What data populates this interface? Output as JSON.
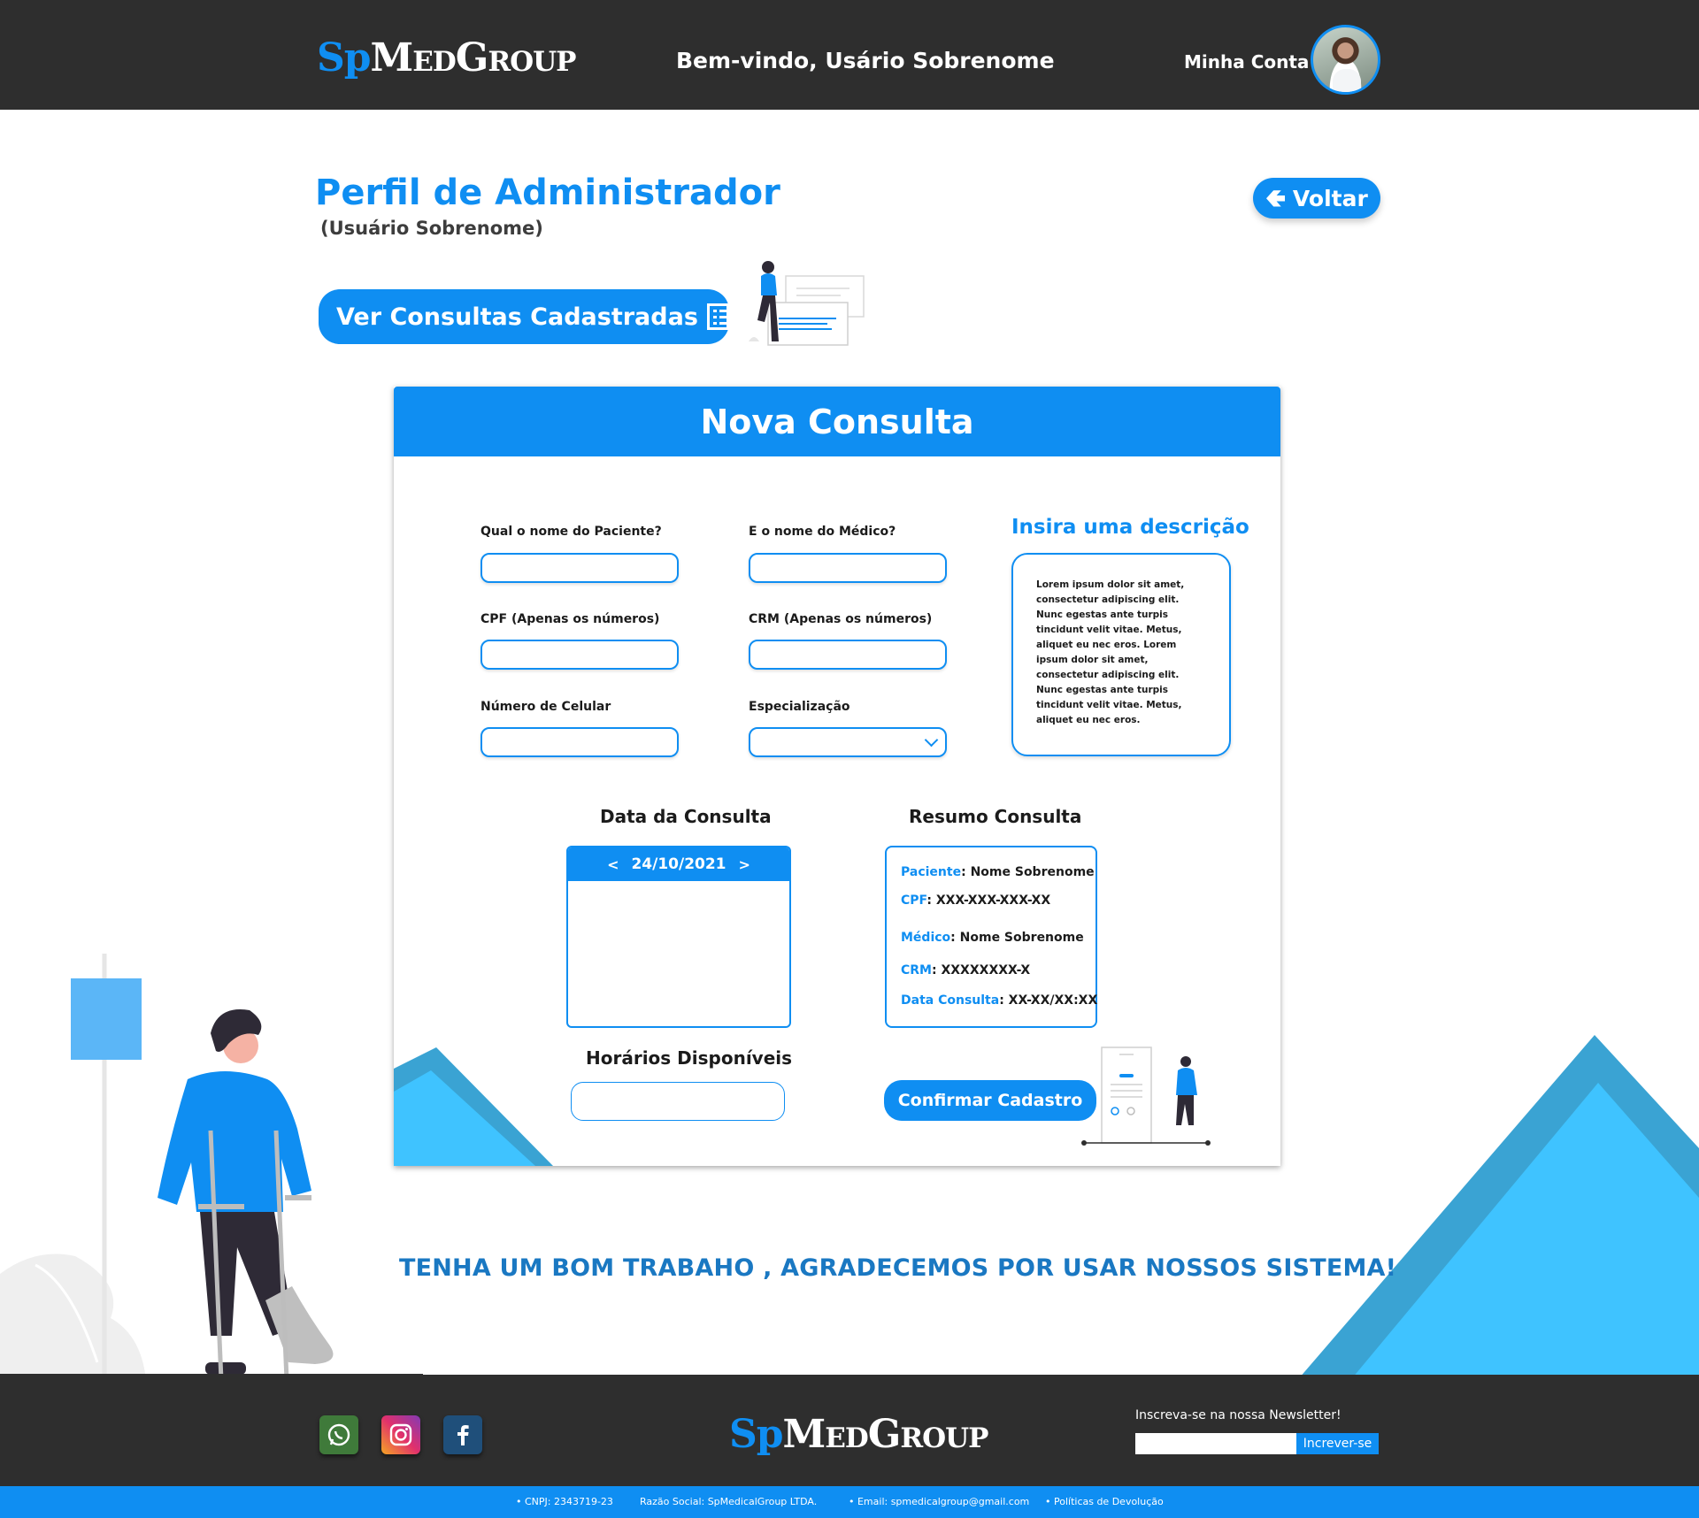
{
  "header": {
    "logo_sp": "Sp",
    "logo_rest": "MedGroup",
    "welcome": "Bem-vindo, Usário Sobrenome",
    "account": "Minha Conta"
  },
  "page": {
    "title": "Perfil de Administrador",
    "subtitle": "(Usuário Sobrenome)",
    "back_label": "Voltar",
    "ver_consultas_label": "Ver Consultas Cadastradas"
  },
  "form": {
    "card_title": "Nova Consulta",
    "fields": {
      "paciente": {
        "label": "Qual o nome do Paciente?",
        "value": ""
      },
      "medico": {
        "label": "E o nome do Médico?",
        "value": ""
      },
      "cpf": {
        "label": "CPF (Apenas os números)",
        "value": ""
      },
      "crm": {
        "label": "CRM (Apenas os números)",
        "value": ""
      },
      "celular": {
        "label": "Número de Celular",
        "value": ""
      },
      "especializacao": {
        "label": "Especialização",
        "selected": ""
      }
    },
    "description": {
      "title": "Insira uma descrição",
      "text": "Lorem ipsum dolor sit amet, consectetur adipiscing elit. Nunc egestas ante turpis tincidunt velit vitae. Metus, aliquet eu nec eros. Lorem ipsum dolor sit amet, consectetur adipiscing elit. Nunc egestas ante turpis tincidunt velit vitae. Metus, aliquet eu nec eros."
    },
    "date": {
      "title": "Data da Consulta",
      "prev": "<",
      "value": "24/10/2021",
      "next": ">"
    },
    "horarios_title": "Horários Disponíveis",
    "summary": {
      "title": "Resumo Consulta",
      "paciente_key": "Paciente",
      "paciente_val": ": Nome Sobrenome",
      "cpf_key": "CPF",
      "cpf_val": ": XXX-XXX-XXX-XX",
      "medico_key": "Médico",
      "medico_val": ": Nome Sobrenome",
      "crm_key": "CRM",
      "crm_val": ": XXXXXXXX-X",
      "data_key": "Data Consulta",
      "data_val": ": XX-XX/XX:XX"
    },
    "confirm_label": "Confirmar Cadastro"
  },
  "thanks": "TENHA UM BOM  TRABAHO , AGRADECEMOS POR USAR NOSSOS SISTEMA!",
  "footer": {
    "logo_sp": "Sp",
    "logo_rest": "MedGroup",
    "newsletter_label": "Inscreva-se na nossa Newsletter!",
    "newsletter_value": "",
    "newsletter_button": "Increver-se",
    "social_icons": [
      "whatsapp-icon",
      "instagram-icon",
      "facebook-icon"
    ],
    "bottom": {
      "cnpj": "• CNPJ: 2343719-23",
      "razao": "Razão Social: SpMedicalGroup LTDA.",
      "email": "• Email: spmedicalgroup@gmail.com",
      "politicas": "• Políticas de Devolução"
    }
  },
  "colors": {
    "primary": "#0f8ef2",
    "dark": "#2e2e2e",
    "light_blue": "#3fc3ff",
    "mid_blue": "#3aa3d3"
  }
}
